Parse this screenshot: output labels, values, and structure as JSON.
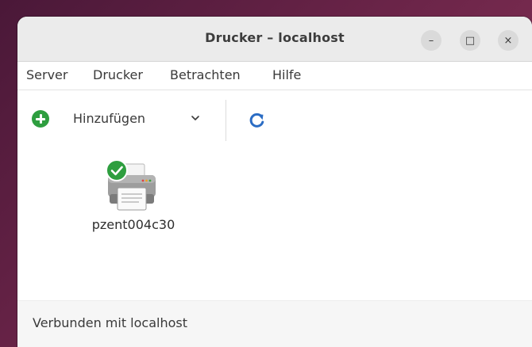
{
  "window": {
    "title": "Drucker – localhost",
    "minimize_glyph": "–",
    "maximize_glyph": "□",
    "close_glyph": "×"
  },
  "menubar": {
    "items": [
      "Server",
      "Drucker",
      "Betrachten",
      "Hilfe"
    ]
  },
  "toolbar": {
    "add_label": "Hinzufügen",
    "add_icon": "plus-circle-icon",
    "dropdown_icon": "chevron-down-icon",
    "refresh_icon": "refresh-icon"
  },
  "printers": [
    {
      "name": "pzent004c30",
      "status_icon": "checkmark-icon",
      "is_default": true
    }
  ],
  "statusbar": {
    "text": "Verbunden mit localhost"
  },
  "colors": {
    "accent_green": "#2e9e3f",
    "refresh_blue": "#2a6cc4",
    "titlebar_bg": "#ebebeb",
    "desktop_bg": "#5b2144"
  }
}
